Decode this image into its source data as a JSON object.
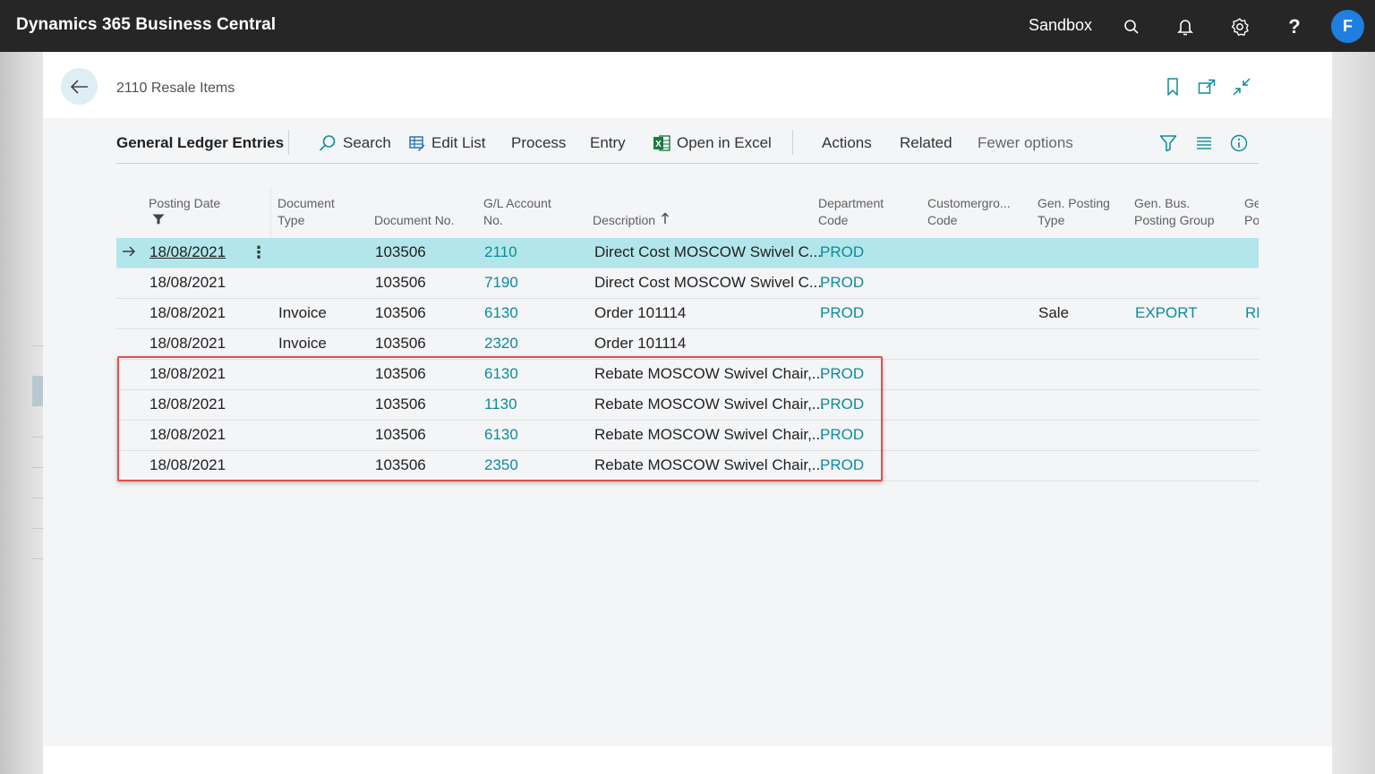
{
  "topbar": {
    "app_title": "Dynamics 365 Business Central",
    "environment": "Sandbox",
    "search_icon": "search-icon",
    "bell_icon": "bell-icon",
    "settings_icon": "gear-icon",
    "help_label": "?",
    "avatar_initial": "F",
    "avatar_color": "#1e7fe0"
  },
  "page": {
    "title": "2110 Resale Items",
    "back_icon": "arrow-left-icon",
    "bookmark_icon": "bookmark-icon",
    "open_new_icon": "open-in-new-window-icon",
    "collapse_icon": "collapse-icon"
  },
  "actionbar": {
    "title": "General Ledger Entries",
    "search": "Search",
    "edit_list": "Edit List",
    "process": "Process",
    "entry": "Entry",
    "open_in_excel": "Open in Excel",
    "actions": "Actions",
    "related": "Related",
    "fewer_options": "Fewer options",
    "filter_icon": "filter-icon",
    "list_icon": "list-view-icon",
    "info_icon": "info-icon"
  },
  "grid": {
    "columns": {
      "posting_date": "Posting Date",
      "document_type_1": "Document",
      "document_type_2": "Type",
      "document_no": "Document No.",
      "gl_account_1": "G/L Account",
      "gl_account_2": "No.",
      "description": "Description",
      "department_1": "Department",
      "department_2": "Code",
      "customergroup_1": "Customergro...",
      "customergroup_2": "Code",
      "gen_posting_1": "Gen. Posting",
      "gen_posting_2": "Type",
      "gen_bus_1": "Gen. Bus.",
      "gen_bus_2": "Posting Group",
      "next_1": "Ge",
      "next_2": "Po"
    },
    "rows": [
      {
        "posting_date": "18/08/2021",
        "doc_type": "",
        "doc_no": "103506",
        "gl_account": "2110",
        "description": "Direct Cost MOSCOW Swivel C...",
        "department": "PROD",
        "gen_posting_type": "",
        "gen_bus_group": "",
        "next_col": ""
      },
      {
        "posting_date": "18/08/2021",
        "doc_type": "",
        "doc_no": "103506",
        "gl_account": "7190",
        "description": "Direct Cost MOSCOW Swivel C...",
        "department": "PROD",
        "gen_posting_type": "",
        "gen_bus_group": "",
        "next_col": ""
      },
      {
        "posting_date": "18/08/2021",
        "doc_type": "Invoice",
        "doc_no": "103506",
        "gl_account": "6130",
        "description": "Order 101114",
        "department": "PROD",
        "gen_posting_type": "Sale",
        "gen_bus_group": "EXPORT",
        "next_col": "RE"
      },
      {
        "posting_date": "18/08/2021",
        "doc_type": "Invoice",
        "doc_no": "103506",
        "gl_account": "2320",
        "description": "Order 101114",
        "department": "",
        "gen_posting_type": "",
        "gen_bus_group": "",
        "next_col": ""
      },
      {
        "posting_date": "18/08/2021",
        "doc_type": "",
        "doc_no": "103506",
        "gl_account": "6130",
        "description": "Rebate MOSCOW Swivel Chair,...",
        "department": "PROD",
        "gen_posting_type": "",
        "gen_bus_group": "",
        "next_col": ""
      },
      {
        "posting_date": "18/08/2021",
        "doc_type": "",
        "doc_no": "103506",
        "gl_account": "1130",
        "description": "Rebate MOSCOW Swivel Chair,...",
        "department": "PROD",
        "gen_posting_type": "",
        "gen_bus_group": "",
        "next_col": ""
      },
      {
        "posting_date": "18/08/2021",
        "doc_type": "",
        "doc_no": "103506",
        "gl_account": "6130",
        "description": "Rebate MOSCOW Swivel Chair,...",
        "department": "PROD",
        "gen_posting_type": "",
        "gen_bus_group": "",
        "next_col": ""
      },
      {
        "posting_date": "18/08/2021",
        "doc_type": "",
        "doc_no": "103506",
        "gl_account": "2350",
        "description": "Rebate MOSCOW Swivel Chair,...",
        "department": "PROD",
        "gen_posting_type": "",
        "gen_bus_group": "",
        "next_col": ""
      }
    ]
  },
  "colors": {
    "topbar": "#262626",
    "selected_row": "#b2e6ea",
    "link": "#0e8a9a",
    "highlight_border": "#e05050"
  }
}
